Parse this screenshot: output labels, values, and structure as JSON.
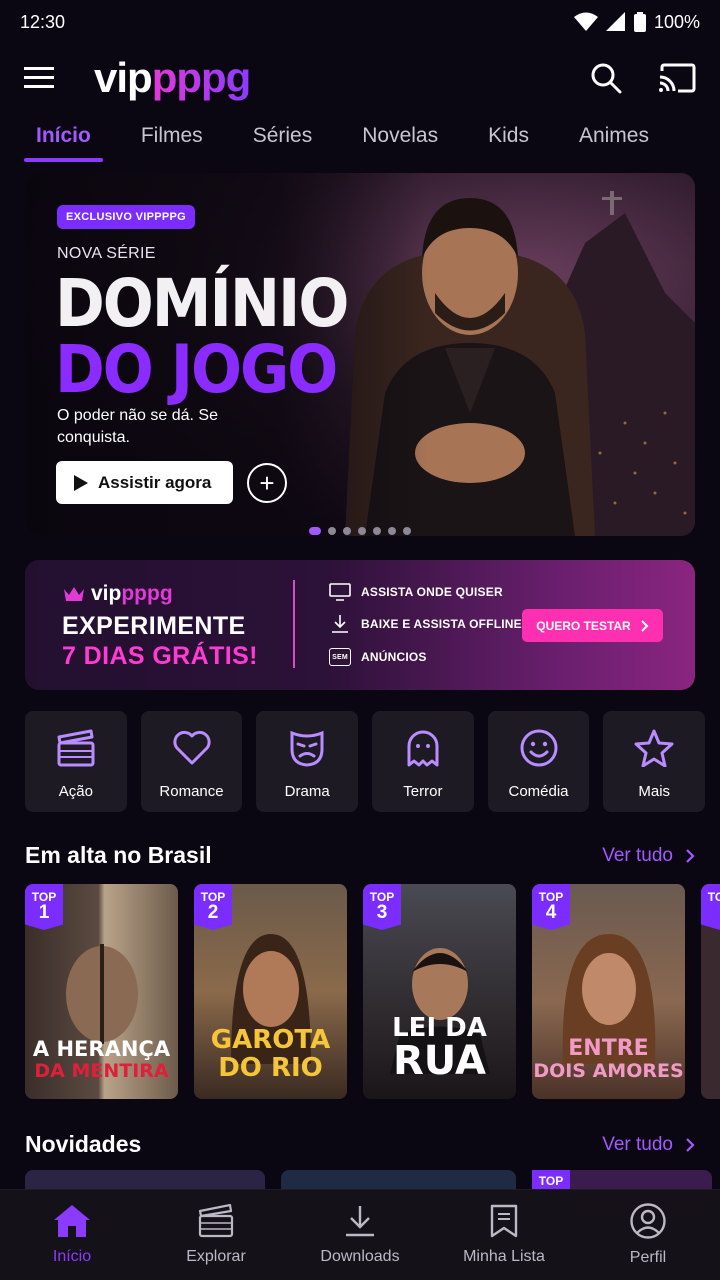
{
  "status_bar": {
    "time": "12:30",
    "battery": "100%"
  },
  "header": {
    "logo_part1": "vip",
    "logo_part2": "pppg"
  },
  "tabs": [
    {
      "label": "Início",
      "active": true
    },
    {
      "label": "Filmes"
    },
    {
      "label": "Séries"
    },
    {
      "label": "Novelas"
    },
    {
      "label": "Kids"
    },
    {
      "label": "Animes"
    }
  ],
  "hero": {
    "badge": "EXCLUSIVO VIPPPPG",
    "kicker": "NOVA SÉRIE",
    "title_line1": "DOMÍNIO",
    "title_line2": "DO JOGO",
    "tagline": "O poder não se dá. Se conquista.",
    "watch_label": "Assistir agora",
    "add_label": "+"
  },
  "promo": {
    "logo_part1": "vip",
    "logo_part2": "pppg",
    "title_line1": "EXPERIMENTE",
    "title_line2": "7 DIAS GRÁTIS!",
    "features": [
      "ASSISTA ONDE QUISER",
      "BAIXE E ASSISTA OFFLINE",
      "ANÚNCIOS"
    ],
    "ads_icon_text": "SEM",
    "cta": "QUERO TESTAR"
  },
  "categories": [
    {
      "label": "Ação",
      "icon": "clapperboard-icon"
    },
    {
      "label": "Romance",
      "icon": "heart-icon"
    },
    {
      "label": "Drama",
      "icon": "mask-icon"
    },
    {
      "label": "Terror",
      "icon": "ghost-icon"
    },
    {
      "label": "Comédia",
      "icon": "smile-icon"
    },
    {
      "label": "Mais",
      "icon": "star-icon"
    }
  ],
  "trending": {
    "title": "Em alta no Brasil",
    "more": "Ver tudo",
    "top_label": "TOP",
    "items": [
      {
        "rank": "1",
        "line1": "A HERANÇA",
        "line2": "DA MENTIRA"
      },
      {
        "rank": "2",
        "line1": "GAROTA",
        "line2": "DO RIO"
      },
      {
        "rank": "3",
        "line1": "LEI DA",
        "line2": "RUA"
      },
      {
        "rank": "4",
        "line1": "ENTRE",
        "line2": "DOIS AMORES"
      }
    ]
  },
  "news": {
    "title": "Novidades",
    "more": "Ver tudo",
    "top_label": "TOP"
  },
  "bottom_nav": [
    {
      "label": "Início",
      "active": true
    },
    {
      "label": "Explorar"
    },
    {
      "label": "Downloads"
    },
    {
      "label": "Minha Lista"
    },
    {
      "label": "Perfil"
    }
  ],
  "colors": {
    "accent": "#8b3bff",
    "pink": "#ff2fb2",
    "background": "#0b0712"
  }
}
